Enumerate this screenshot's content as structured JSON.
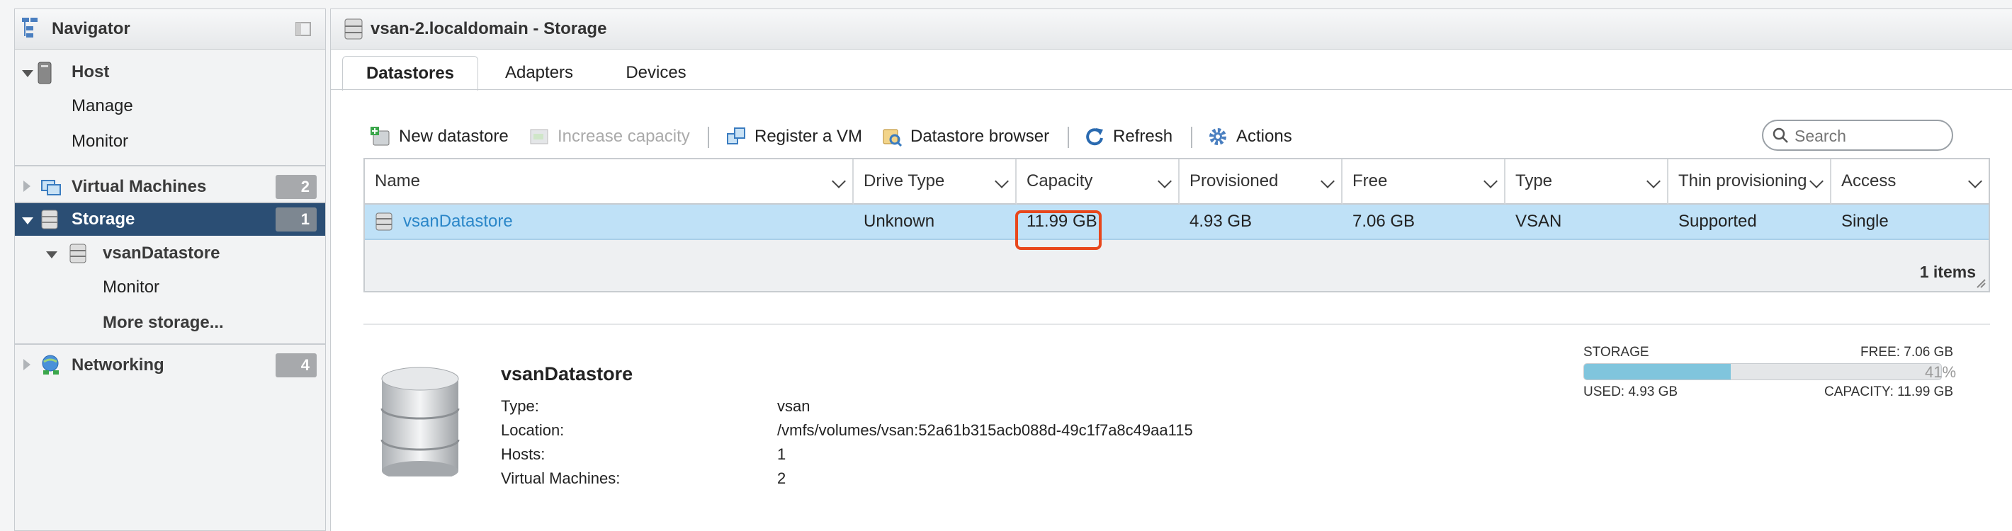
{
  "navigator": {
    "title": "Navigator",
    "items": [
      {
        "label": "Host"
      },
      {
        "label": "Manage"
      },
      {
        "label": "Monitor"
      },
      {
        "label": "Virtual Machines",
        "count": "2"
      },
      {
        "label": "Storage",
        "count": "1"
      },
      {
        "label": "vsanDatastore"
      },
      {
        "label": "Monitor"
      },
      {
        "label": "More storage..."
      },
      {
        "label": "Networking",
        "count": "4"
      }
    ]
  },
  "window": {
    "title": "vsan-2.localdomain - Storage"
  },
  "tabs": [
    {
      "label": "Datastores",
      "active": true
    },
    {
      "label": "Adapters"
    },
    {
      "label": "Devices"
    }
  ],
  "toolbar": {
    "new_datastore": "New datastore",
    "increase_capacity": "Increase capacity",
    "register_vm": "Register a VM",
    "datastore_browser": "Datastore browser",
    "refresh": "Refresh",
    "actions": "Actions",
    "search_placeholder": "Search"
  },
  "table": {
    "columns": [
      "Name",
      "Drive Type",
      "Capacity",
      "Provisioned",
      "Free",
      "Type",
      "Thin provisioning",
      "Access"
    ],
    "rows": [
      {
        "name": "vsanDatastore",
        "drive_type": "Unknown",
        "capacity": "11.99 GB",
        "provisioned": "4.93 GB",
        "free": "7.06 GB",
        "type": "VSAN",
        "thin": "Supported",
        "access": "Single"
      }
    ],
    "items_count": "1 items"
  },
  "details": {
    "name": "vsanDatastore",
    "fields": [
      {
        "key": "Type:",
        "value": "vsan"
      },
      {
        "key": "Location:",
        "value": "/vmfs/volumes/vsan:52a61b315acb088d-49c1f7a8c49aa115"
      },
      {
        "key": "Hosts:",
        "value": "1"
      },
      {
        "key": "Virtual Machines:",
        "value": "2"
      }
    ]
  },
  "storage_meter": {
    "label": "STORAGE",
    "free": "FREE: 7.06 GB",
    "percent_text": "41%",
    "used_fraction": 0.41,
    "used": "USED: 4.93 GB",
    "capacity": "CAPACITY: 11.99 GB"
  },
  "colors": {
    "selected_nav": "#2b4e74",
    "row_highlight": "#bfe1f7",
    "annotation": "#e8471c",
    "bar_fill": "#80c5dd"
  }
}
